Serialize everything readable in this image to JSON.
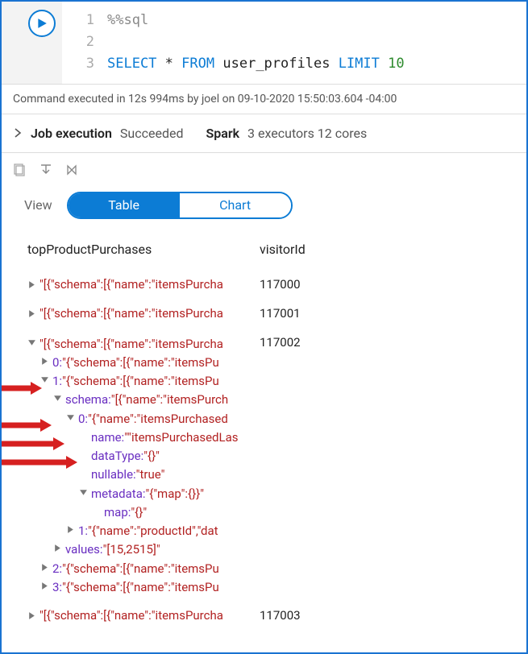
{
  "code": {
    "line1": "%%sql",
    "line3_select": "SELECT",
    "line3_star": "*",
    "line3_from": "FROM",
    "line3_table": "user_profiles",
    "line3_limit": "LIMIT",
    "line3_n": "10"
  },
  "status": "Command executed in 12s 994ms by joel on 09-10-2020 15:50:03.604 -04:00",
  "job": {
    "label": "Job execution",
    "state": "Succeeded",
    "spark_label": "Spark",
    "spark_detail": "3 executors 12 cores"
  },
  "view": {
    "label": "View",
    "table": "Table",
    "chart": "Chart"
  },
  "columns": {
    "c1": "topProductPurchases",
    "c2": "visitorId"
  },
  "rows": {
    "r0": {
      "v": "\"[{\"schema\":[{\"name\":\"itemsPurcha",
      "id": "117000"
    },
    "r1": {
      "v": "\"[{\"schema\":[{\"name\":\"itemsPurcha",
      "id": "117001"
    },
    "r2": {
      "v": "\"[{\"schema\":[{\"name\":\"itemsPurcha",
      "id": "117002"
    },
    "r3": {
      "v": "\"[{\"schema\":[{\"name\":\"itemsPurcha",
      "id": "117003"
    }
  },
  "tree": {
    "n0": "0: ",
    "n0v": "\"{\"schema\":[{\"name\":\"itemsPu",
    "n1": "1: ",
    "n1v": "\"{\"schema\":[{\"name\":\"itemsPu",
    "schema_k": "schema: ",
    "schema_v": "\"[{\"name\":\"itemsPurch",
    "s0": "0: ",
    "s0v": "\"{\"name\":\"itemsPurchased",
    "name_k": "name: ",
    "name_v": "\"\"itemsPurchasedLas",
    "dtype_k": "dataType: ",
    "dtype_v": "\"{}\"",
    "null_k": "nullable: ",
    "null_v": "\"true\"",
    "meta_k": "metadata: ",
    "meta_v": "\"{\"map\":{}}\"",
    "map_k": "map: ",
    "map_v": "\"{}\"",
    "s1": "1: ",
    "s1v": "\"{\"name\":\"productId\",\"dat",
    "values_k": "values: ",
    "values_v": "\"[15,2515]\"",
    "n2": "2: ",
    "n2v": "\"{\"schema\":[{\"name\":\"itemsPu",
    "n3": "3: ",
    "n3v": "\"{\"schema\":[{\"name\":\"itemsPu"
  }
}
